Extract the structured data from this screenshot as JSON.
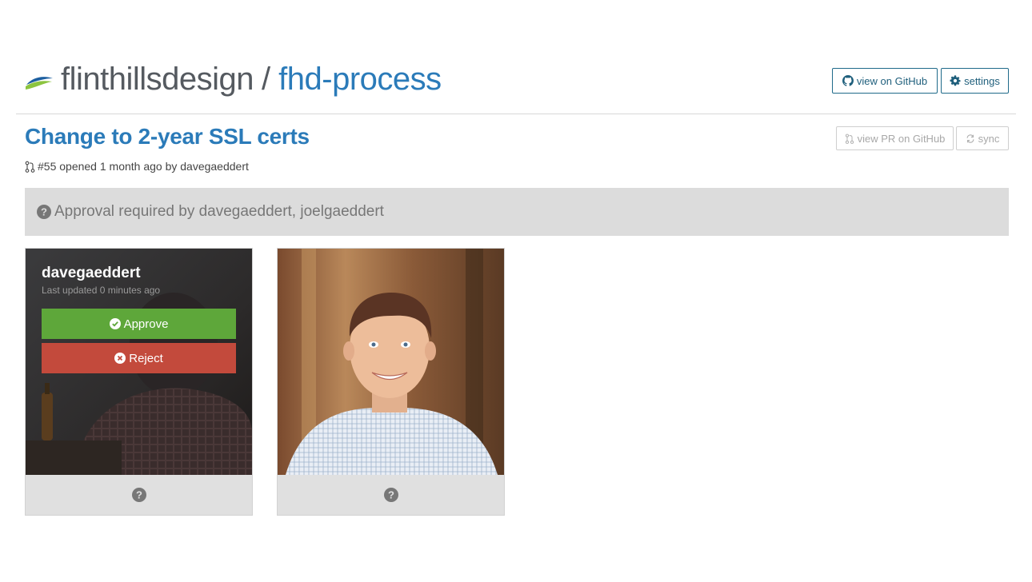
{
  "header": {
    "owner": "flinthillsdesign",
    "separator": "/",
    "repo": "fhd-process",
    "view_github_label": "view on GitHub",
    "settings_label": "settings"
  },
  "pr": {
    "title": "Change to 2-year SSL certs",
    "meta": "#55 opened 1 month ago by davegaeddert",
    "view_pr_label": "view PR on GitHub",
    "sync_label": "sync"
  },
  "approval": {
    "text": "Approval required by davegaeddert, joelgaeddert"
  },
  "cards": [
    {
      "username": "davegaeddert",
      "updated": "Last updated 0 minutes ago",
      "approve_label": "Approve",
      "reject_label": "Reject"
    },
    {
      "status_icon": "question-circle-icon"
    }
  ],
  "colors": {
    "link_blue": "#2b7bb9",
    "approve_green": "#5ea73a",
    "reject_red": "#c34a3c",
    "bar_gray": "#dcdcdc"
  }
}
